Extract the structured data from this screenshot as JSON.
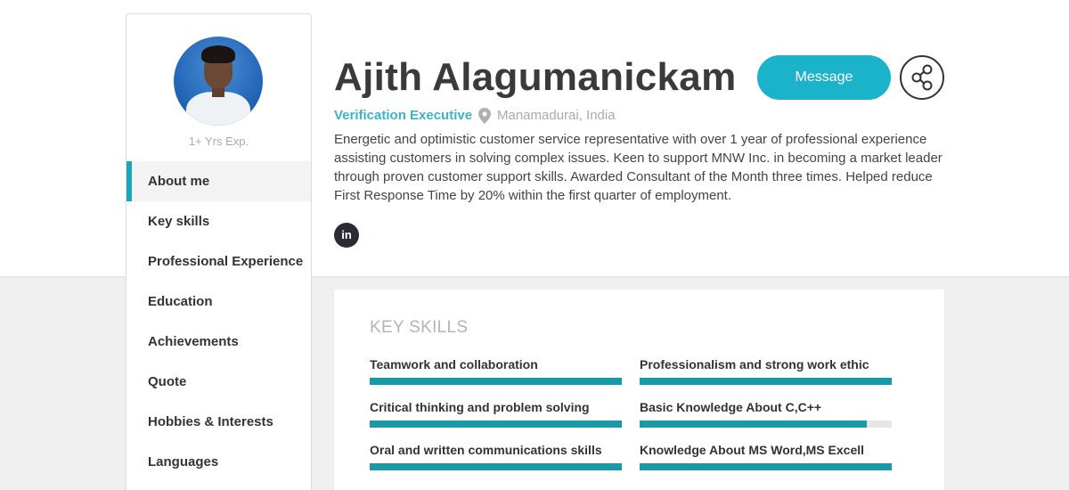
{
  "profile": {
    "name": "Ajith Alagumanickam",
    "role": "Verification Executive",
    "location": "Manamadurai, India",
    "experience": "1+ Yrs Exp.",
    "summary": "Energetic and optimistic customer service representative with over 1 year of professional experience assisting customers in solving complex issues. Keen to support MNW Inc. in becoming a market leader through proven customer support skills. Awarded Consultant of the Month three times. Helped reduce First Response Time by 20% within the first quarter of employment.",
    "linkedin_label": "in"
  },
  "actions": {
    "message_label": "Message"
  },
  "nav": {
    "items": [
      {
        "label": "About me",
        "active": true
      },
      {
        "label": "Key skills",
        "active": false
      },
      {
        "label": "Professional Experience",
        "active": false
      },
      {
        "label": "Education",
        "active": false
      },
      {
        "label": "Achievements",
        "active": false
      },
      {
        "label": "Quote",
        "active": false
      },
      {
        "label": "Hobbies & Interests",
        "active": false
      },
      {
        "label": "Languages",
        "active": false
      }
    ]
  },
  "skills": {
    "title": "KEY SKILLS",
    "items": [
      {
        "label": "Teamwork and collaboration",
        "level": 100
      },
      {
        "label": "Professionalism and strong work ethic",
        "level": 100
      },
      {
        "label": "Critical thinking and problem solving",
        "level": 100
      },
      {
        "label": "Basic Knowledge About C,C++",
        "level": 90
      },
      {
        "label": "Oral and written communications skills",
        "level": 100
      },
      {
        "label": "Knowledge About MS Word,MS Excell",
        "level": 100
      }
    ]
  },
  "colors": {
    "accent": "#1bb3c9",
    "role": "#3db3c9",
    "skill_bar": "#1a9aa6"
  }
}
